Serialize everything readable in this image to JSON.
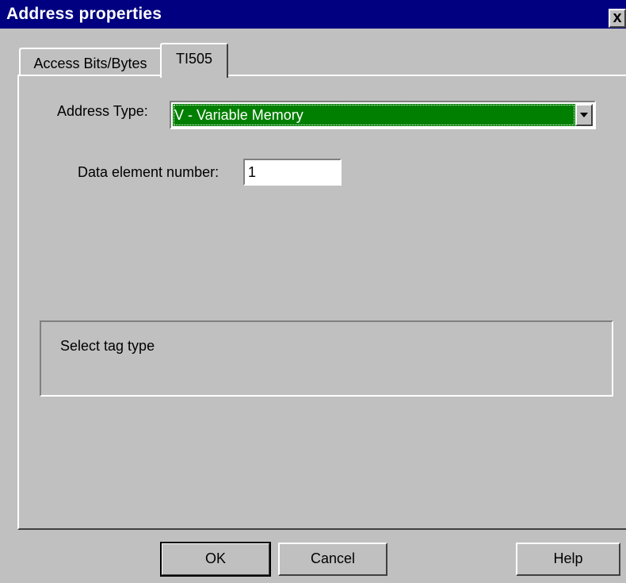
{
  "window": {
    "title": "Address properties",
    "close_label": "x"
  },
  "tabs": [
    {
      "label": "Access Bits/Bytes",
      "active": false
    },
    {
      "label": "TI505",
      "active": true
    }
  ],
  "form": {
    "address_type_label": "Address Type:",
    "address_type_value": "V - Variable Memory",
    "data_element_label": "Data element number:",
    "data_element_value": "1"
  },
  "status": {
    "text": "Select tag type"
  },
  "buttons": {
    "ok": "OK",
    "cancel": "Cancel",
    "help": "Help"
  },
  "colors": {
    "titlebar": "#000080",
    "selection": "#007f00",
    "face": "#c0c0c0"
  }
}
